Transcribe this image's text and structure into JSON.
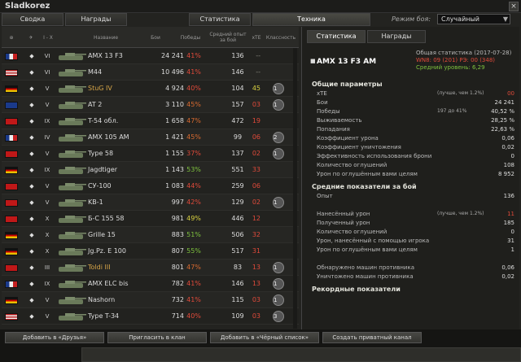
{
  "window": {
    "title": "Sladkorez",
    "close": "×"
  },
  "tabs": [
    "Сводка",
    "Награды",
    "Статистика",
    "Техника"
  ],
  "mode": {
    "label": "Режим боя:",
    "value": "Случайный",
    "arrow": "▼"
  },
  "columns": {
    "type": "",
    "tier": "I - X",
    "name": "Название",
    "battles": "Бои",
    "wins": "Победы",
    "avg": "Средний опыт за бой",
    "xte": "xTE",
    "mastery": "Классность"
  },
  "rows": [
    {
      "flag": "fr",
      "tier": "VI",
      "name": "AMX 13 F3",
      "gold": false,
      "battles": "24 241",
      "wins": "41%",
      "wc": "r",
      "avg": "136",
      "xte": "--",
      "xc": "gr",
      "mast": ""
    },
    {
      "flag": "us",
      "tier": "VI",
      "name": "M44",
      "gold": false,
      "battles": "10 496",
      "wins": "41%",
      "wc": "r",
      "avg": "146",
      "xte": "--",
      "xc": "gr",
      "mast": ""
    },
    {
      "flag": "de",
      "tier": "V",
      "name": "StuG IV",
      "gold": true,
      "battles": "4 924",
      "wins": "40%",
      "wc": "r",
      "avg": "104",
      "xte": "45",
      "xc": "y",
      "mast": "1"
    },
    {
      "flag": "uk",
      "tier": "V",
      "name": "AT 2",
      "gold": false,
      "battles": "3 110",
      "wins": "45%",
      "wc": "o",
      "avg": "157",
      "xte": "03",
      "xc": "r",
      "mast": "1"
    },
    {
      "flag": "su",
      "tier": "IX",
      "name": "T-54 обл.",
      "gold": false,
      "battles": "1 658",
      "wins": "47%",
      "wc": "o",
      "avg": "472",
      "xte": "19",
      "xc": "r",
      "mast": ""
    },
    {
      "flag": "fr",
      "tier": "IV",
      "name": "AMX 105 AM",
      "gold": false,
      "battles": "1 421",
      "wins": "45%",
      "wc": "o",
      "avg": "99",
      "xte": "06",
      "xc": "r",
      "mast": "2"
    },
    {
      "flag": "cn",
      "tier": "V",
      "name": "Type 58",
      "gold": false,
      "battles": "1 155",
      "wins": "37%",
      "wc": "r",
      "avg": "137",
      "xte": "02",
      "xc": "r",
      "mast": "1"
    },
    {
      "flag": "de",
      "tier": "IX",
      "name": "Jagdtiger",
      "gold": false,
      "battles": "1 143",
      "wins": "53%",
      "wc": "g",
      "avg": "551",
      "xte": "33",
      "xc": "r",
      "mast": ""
    },
    {
      "flag": "su",
      "tier": "V",
      "name": "СУ-100",
      "gold": false,
      "battles": "1 083",
      "wins": "44%",
      "wc": "r",
      "avg": "259",
      "xte": "06",
      "xc": "r",
      "mast": ""
    },
    {
      "flag": "su",
      "tier": "V",
      "name": "KB-1",
      "gold": false,
      "battles": "997",
      "wins": "42%",
      "wc": "r",
      "avg": "129",
      "xte": "02",
      "xc": "r",
      "mast": "1"
    },
    {
      "flag": "su",
      "tier": "X",
      "name": "Б-С 155 58",
      "gold": false,
      "battles": "981",
      "wins": "49%",
      "wc": "y",
      "avg": "446",
      "xte": "12",
      "xc": "r",
      "mast": ""
    },
    {
      "flag": "de",
      "tier": "X",
      "name": "Grille 15",
      "gold": false,
      "battles": "883",
      "wins": "51%",
      "wc": "g",
      "avg": "506",
      "xte": "32",
      "xc": "r",
      "mast": ""
    },
    {
      "flag": "de",
      "tier": "X",
      "name": "Jg.Pz. E 100",
      "gold": false,
      "battles": "807",
      "wins": "55%",
      "wc": "g",
      "avg": "517",
      "xte": "31",
      "xc": "r",
      "mast": ""
    },
    {
      "flag": "cn",
      "tier": "III",
      "name": "Toldi III",
      "gold": true,
      "battles": "801",
      "wins": "47%",
      "wc": "o",
      "avg": "83",
      "xte": "13",
      "xc": "r",
      "mast": "1"
    },
    {
      "flag": "fr",
      "tier": "IX",
      "name": "AMX ELC bis",
      "gold": false,
      "battles": "782",
      "wins": "41%",
      "wc": "r",
      "avg": "146",
      "xte": "13",
      "xc": "r",
      "mast": "1"
    },
    {
      "flag": "de",
      "tier": "V",
      "name": "Nashorn",
      "gold": false,
      "battles": "732",
      "wins": "41%",
      "wc": "r",
      "avg": "115",
      "xte": "03",
      "xc": "r",
      "mast": "1"
    },
    {
      "flag": "us",
      "tier": "V",
      "name": "Type T-34",
      "gold": false,
      "battles": "714",
      "wins": "40%",
      "wc": "r",
      "avg": "109",
      "xte": "03",
      "xc": "r",
      "mast": "3"
    }
  ],
  "right": {
    "tabs": [
      "Статистика",
      "Награды"
    ],
    "vehicle": "AMX 13 F3 AM",
    "meta1": "Общая статистика (2017-07-28)",
    "meta2": "WN8: 09 (201) РЭ: 00 (348)",
    "meta3": "Средний уровень: 6,29",
    "sec1": "Общие параметры",
    "stats1": [
      {
        "l": "xTE",
        "m": "(лучше, чем 1.2%)",
        "v": "00"
      },
      {
        "l": "Бои",
        "m": "",
        "v": "24 241"
      },
      {
        "l": "Победы",
        "m": "197 до 41%",
        "v": "40,52 %"
      },
      {
        "l": "Выживаемость",
        "m": "",
        "v": "28,25 %"
      },
      {
        "l": "Попадания",
        "m": "",
        "v": "22,63 %"
      },
      {
        "l": "Коэффициент урона",
        "m": "",
        "v": "0,06"
      },
      {
        "l": "Коэффициент уничтожения",
        "m": "",
        "v": "0,02"
      },
      {
        "l": "Эффективность использования брони",
        "m": "",
        "v": "0"
      },
      {
        "l": "Количество оглушений",
        "m": "",
        "v": "108"
      },
      {
        "l": "Урон по оглушённым вами целям",
        "m": "",
        "v": "8 952"
      }
    ],
    "sec2": "Средние показатели за бой",
    "stats2": [
      {
        "l": "Опыт",
        "m": "",
        "v": "136"
      },
      {
        "l": "",
        "m": "",
        "v": ""
      },
      {
        "l": "Нанесённый урон",
        "m": "(лучше, чем 1.2%)",
        "v": "11"
      },
      {
        "l": "Полученный урон",
        "m": "",
        "v": "185"
      },
      {
        "l": "Количество оглушений",
        "m": "",
        "v": "0"
      },
      {
        "l": "Урон, нанесённый с помощью игрока",
        "m": "",
        "v": "31"
      },
      {
        "l": "Урон по оглушённым вами целям",
        "m": "",
        "v": "1"
      },
      {
        "l": "",
        "m": "",
        "v": ""
      },
      {
        "l": "Обнаружено машин противника",
        "m": "",
        "v": "0,06"
      },
      {
        "l": "Уничтожено машин противника",
        "m": "",
        "v": "0,02"
      }
    ],
    "sec3": "Рекордные показатели"
  },
  "bottom": {
    "b1": "Добавить в «Друзья»",
    "b2": "Пригласить в клан",
    "b3": "Добавить в «Чёрный список»",
    "b4": "Создать приватный канал"
  }
}
